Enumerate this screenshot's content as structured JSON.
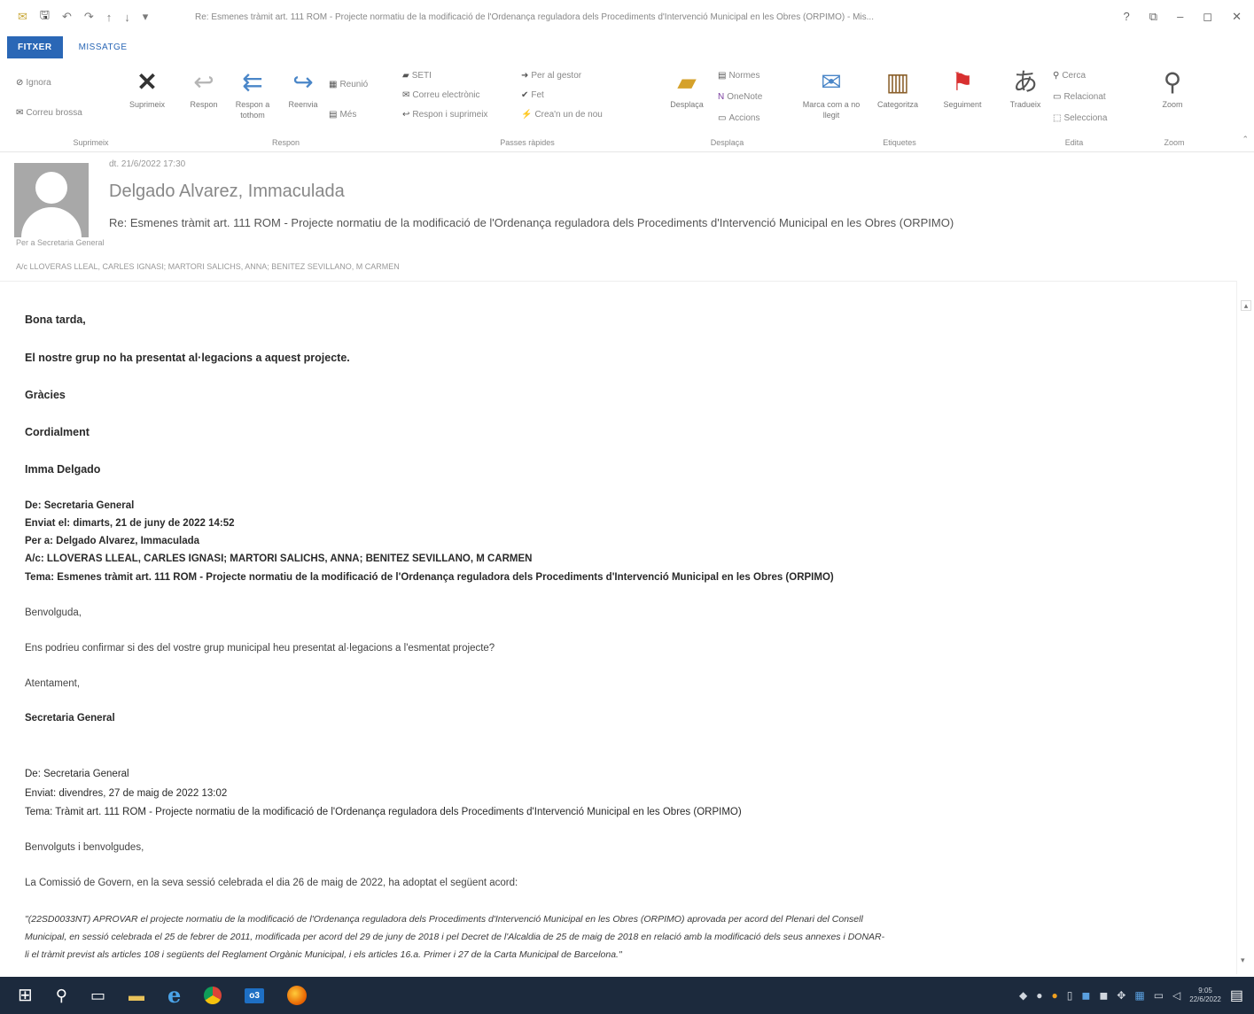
{
  "window": {
    "title": "Re: Esmenes tràmit art. 111 ROM - Projecte normatiu de la modificació de l'Ordenança reguladora dels Procediments d'Intervenció Municipal en les Obres (ORPIMO) - Mis...",
    "help": "?",
    "restore_label": "⧉",
    "minimize_label": "–",
    "maximize_label": "◻",
    "close_label": "✕"
  },
  "tabs": {
    "file": "FITXER",
    "message": "MISSATGE"
  },
  "ribbon": {
    "suprimeix": {
      "ignore": "Ignora",
      "junk": "Correu brossa",
      "delete": "Suprimeix",
      "label": "Suprimeix"
    },
    "respon": {
      "reply": "Respon",
      "reply_all": "Respon a tothom",
      "forward": "Reenvia",
      "meeting": "Reunió",
      "more": "Més",
      "label": "Respon"
    },
    "passes": {
      "item1": "SETI",
      "item2": "Correu electrònic",
      "item3": "Respon i suprimeix",
      "item4": "Per al gestor",
      "item5": "Fet",
      "item6": "Crea'n un de nou",
      "label": "Passes ràpides"
    },
    "desplaca": {
      "move": "Desplaça",
      "rules": "Normes",
      "onenote": "OneNote",
      "actions": "Accions",
      "label": "Desplaça"
    },
    "etiquetes": {
      "unread": "Marca com a no llegit",
      "categorize": "Categoritza",
      "followup": "Seguiment",
      "label": "Etiquetes"
    },
    "edita": {
      "translate": "Tradueix",
      "find": "Cerca",
      "related": "Relacionat",
      "select": "Selecciona",
      "label": "Edita"
    },
    "zoom": {
      "zoom": "Zoom",
      "label": "Zoom"
    }
  },
  "header": {
    "date": "dt. 21/6/2022 17:30",
    "sender": "Delgado Alvarez, Immaculada",
    "subject": "Re: Esmenes tràmit art. 111 ROM - Projecte normatiu de la modificació de l'Ordenança reguladora dels Procediments d'Intervenció Municipal en les Obres (ORPIMO)",
    "to": "Per a   Secretaria General",
    "cc": "A/c   LLOVERAS LLEAL, CARLES IGNASI; MARTORI SALICHS, ANNA; BENITEZ SEVILLANO, M CARMEN"
  },
  "body": {
    "greeting": "Bona tarda,",
    "line1": "El nostre grup no ha presentat al·legacions a aquest projecte.",
    "thanks": "Gràcies",
    "regards": "Cordialment",
    "signature": "Imma Delgado",
    "q1_from": "De: Secretaria General",
    "q1_sent": "Enviat el: dimarts, 21 de juny de 2022 14:52",
    "q1_to": "Per a: Delgado Alvarez, Immaculada",
    "q1_cc": "A/c: LLOVERAS LLEAL, CARLES IGNASI; MARTORI SALICHS, ANNA; BENITEZ SEVILLANO, M CARMEN",
    "q1_subject": "Tema: Esmenes tràmit art. 111 ROM - Projecte normatiu de la modificació de l'Ordenança reguladora dels Procediments d'Intervenció Municipal en les Obres (ORPIMO)",
    "q1_greeting": "Benvolguda,",
    "q1_text": "Ens podrieu confirmar si des del vostre grup municipal heu presentat al·legacions a l'esmentat projecte?",
    "q1_closing": "Atentament,",
    "q1_sig": "Secretaria General",
    "q2_from": "De: Secretaria General",
    "q2_sent": "Enviat: divendres, 27 de maig de 2022 13:02",
    "q2_subject": "Tema: Tràmit art. 111 ROM - Projecte normatiu de la modificació de l'Ordenança reguladora dels Procediments d'Intervenció Municipal en les Obres (ORPIMO)",
    "q2_greeting": "Benvolguts i benvolgudes,",
    "q2_text": "La Comissió de Govern, en la seva sessió celebrada el dia 26 de maig de 2022, ha adoptat el següent acord:",
    "q2_quote1": "\"(22SD0033NT) APROVAR el projecte normatiu de la modificació de l'Ordenança reguladora dels Procediments d'Intervenció Municipal en les Obres (ORPIMO) aprovada per acord del Plenari del Consell",
    "q2_quote2": "Municipal, en sessió celebrada el 25 de febrer de 2011, modificada per acord del 29 de juny de 2018 i pel Decret de l'Alcaldia de 25 de maig de 2018 en relació amb la modificació dels seus annexes i DONAR-",
    "q2_quote3": "li el tràmit previst als articles 108 i següents del Reglament Orgànic Municipal, i els articles 16.a. Primer i 27 de la Carta Municipal de Barcelona.\""
  },
  "taskbar": {
    "time": "9:05",
    "date": "22/6/2022",
    "outlook": "o3"
  }
}
